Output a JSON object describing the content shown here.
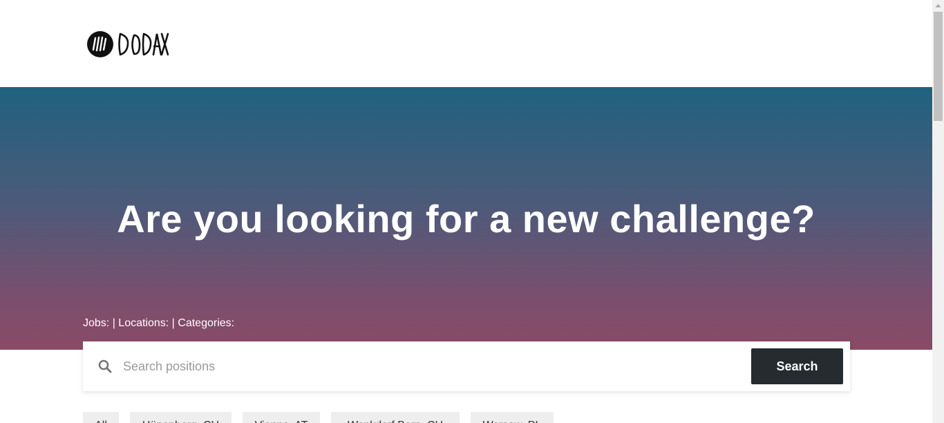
{
  "brand": {
    "logo_text": "DODAX"
  },
  "hero": {
    "title": "Are you looking for a new challenge?",
    "stats": "Jobs: | Locations: | Categories:"
  },
  "search": {
    "placeholder": "Search positions",
    "value": "",
    "button_label": "Search"
  },
  "filters": [
    "All",
    "Hünenberg, CH",
    "Vienna, AT",
    "Wankdorf Bern, CH",
    "Warsaw, PL"
  ],
  "colors": {
    "hero_top": "#1f627e",
    "hero_bottom": "#8a4a66",
    "button": "#252b2e"
  }
}
